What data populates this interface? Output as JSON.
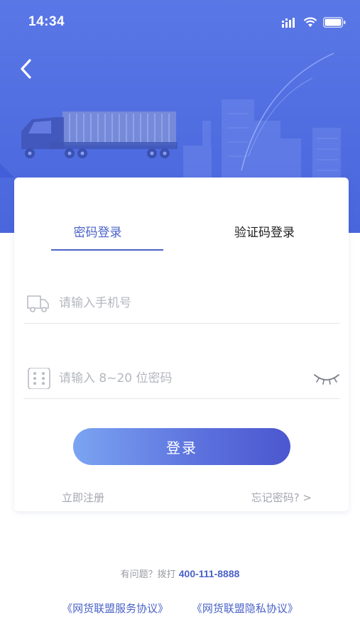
{
  "status_bar": {
    "time": "14:34"
  },
  "tabs": [
    {
      "label": "密码登录",
      "active": true
    },
    {
      "label": "验证码登录",
      "active": false
    }
  ],
  "form": {
    "phone_placeholder": "请输入手机号",
    "password_placeholder": "请输入 8~20 位密码"
  },
  "login_label": "登录",
  "links": {
    "register": "立即注册",
    "forgot": "忘记密码? >"
  },
  "help": {
    "prefix": "有问题？拨打",
    "phone": "400-111-8888"
  },
  "agreements": [
    "《网货联盟服务协议》",
    "《网货联盟隐私协议》"
  ],
  "colors": {
    "brand": "#4a62c8",
    "hero": "#5a77e6",
    "muted": "#a3a6ae"
  }
}
